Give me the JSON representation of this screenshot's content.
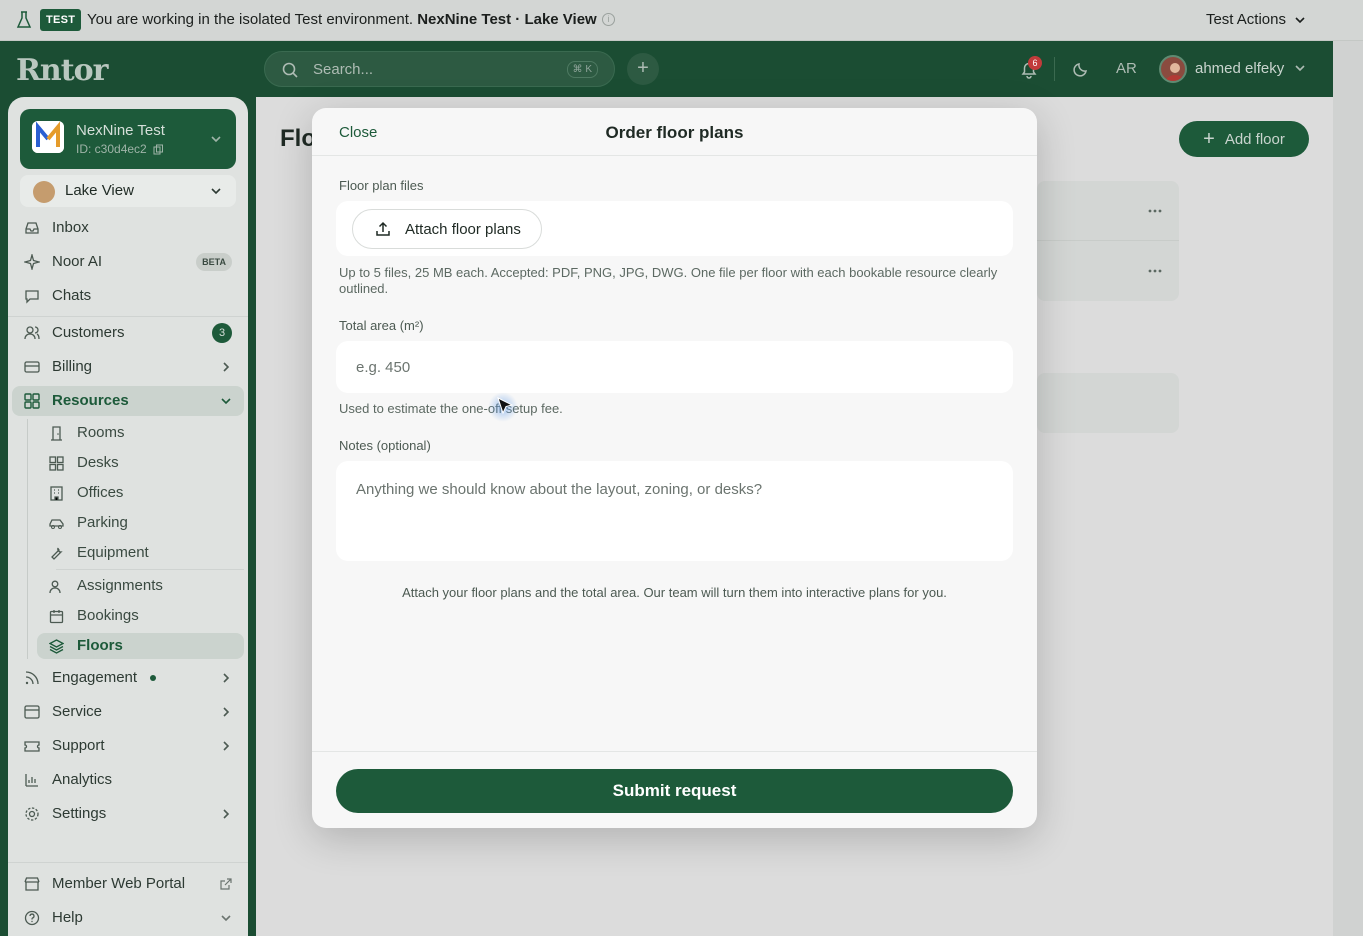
{
  "banner": {
    "badge": "TEST",
    "message_prefix": "You are working in the isolated Test environment. ",
    "message_env": "NexNine Test · Lake View",
    "actions_label": "Test Actions"
  },
  "topbar": {
    "logo": "Rntor",
    "search_placeholder": "Search...",
    "search_shortcut": "⌘ K",
    "notification_count": "6",
    "language": "AR",
    "user_name": "ahmed elfeky"
  },
  "sidebar": {
    "org_name": "NexNine Test",
    "org_id": "ID: c30d4ec2",
    "location": "Lake View",
    "items": {
      "inbox": "Inbox",
      "noor_ai": "Noor AI",
      "noor_ai_badge": "BETA",
      "chats": "Chats",
      "customers": "Customers",
      "customers_count": "3",
      "billing": "Billing",
      "resources": "Resources",
      "rooms": "Rooms",
      "desks": "Desks",
      "offices": "Offices",
      "parking": "Parking",
      "equipment": "Equipment",
      "assignments": "Assignments",
      "bookings": "Bookings",
      "floors": "Floors",
      "engagement": "Engagement",
      "service": "Service",
      "support": "Support",
      "analytics": "Analytics",
      "settings": "Settings",
      "member_portal": "Member Web Portal",
      "help": "Help"
    }
  },
  "main": {
    "page_title": "Flo",
    "add_floor": "Add floor"
  },
  "modal": {
    "close": "Close",
    "title": "Order floor plans",
    "files_label": "Floor plan files",
    "attach_button": "Attach floor plans",
    "files_help": "Up to 5 files, 25 MB each. Accepted: PDF, PNG, JPG, DWG. One file per floor with each bookable resource clearly outlined.",
    "area_label": "Total area (m²)",
    "area_placeholder": "e.g. 450",
    "area_help": "Used to estimate the one-off setup fee.",
    "notes_label": "Notes (optional)",
    "notes_placeholder": "Anything we should know about the layout, zoning, or desks?",
    "footer_note": "Attach your floor plans and the total area. Our team will turn them into interactive plans for you.",
    "submit": "Submit request"
  }
}
